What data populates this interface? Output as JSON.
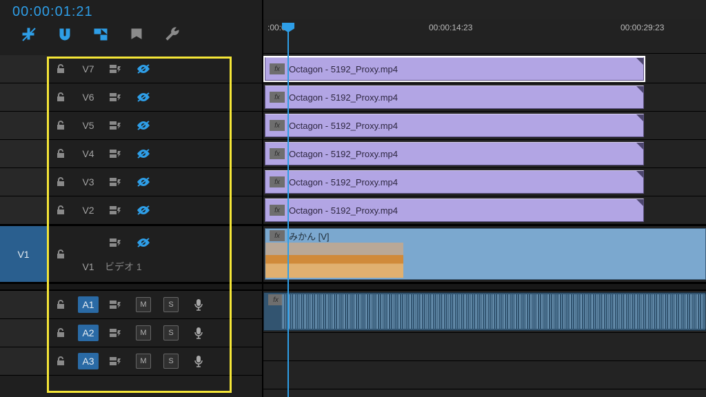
{
  "timecode": "00:00:01:21",
  "ruler": {
    "t0": ":00:00",
    "t1": "00:00:14:23",
    "t2": "00:00:29:23"
  },
  "video_tracks": [
    {
      "id": "V7",
      "vis_off": true,
      "clip": "Octagon - 5192_Proxy.mp4",
      "selected": true
    },
    {
      "id": "V6",
      "vis_off": true,
      "clip": "Octagon - 5192_Proxy.mp4"
    },
    {
      "id": "V5",
      "vis_off": true,
      "clip": "Octagon - 5192_Proxy.mp4"
    },
    {
      "id": "V4",
      "vis_off": true,
      "clip": "Octagon - 5192_Proxy.mp4"
    },
    {
      "id": "V3",
      "vis_off": true,
      "clip": "Octagon - 5192_Proxy.mp4"
    },
    {
      "id": "V2",
      "vis_off": true,
      "clip": "Octagon - 5192_Proxy.mp4"
    }
  ],
  "v1": {
    "src": "V1",
    "id": "V1",
    "name": "ビデオ 1",
    "clip": "みかん [V]"
  },
  "audio_tracks": [
    {
      "id": "A1",
      "mute": "M",
      "solo": "S"
    },
    {
      "id": "A2",
      "mute": "M",
      "solo": "S"
    },
    {
      "id": "A3",
      "mute": "M",
      "solo": "S"
    }
  ],
  "fx_label": "fx"
}
